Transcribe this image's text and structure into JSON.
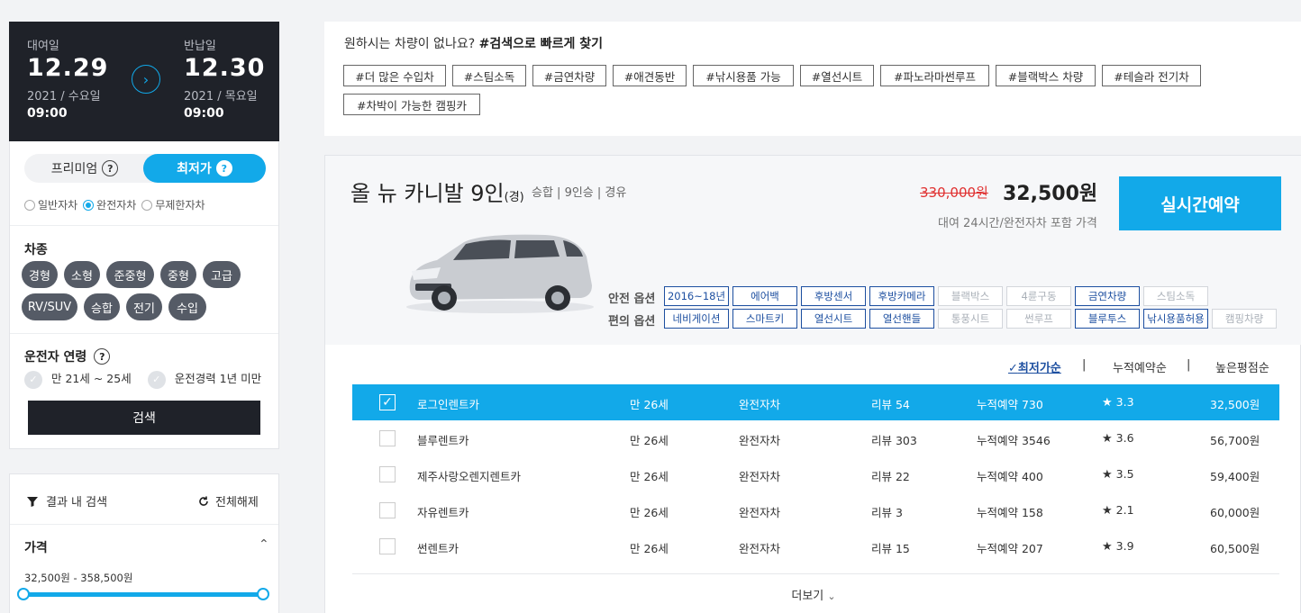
{
  "dates": {
    "pickup": {
      "label": "대여일",
      "date": "12.29",
      "sub": "2021 / 수요일",
      "time": "09:00"
    },
    "return": {
      "label": "반납일",
      "date": "12.30",
      "sub": "2021 / 목요일",
      "time": "09:00"
    }
  },
  "toggle": {
    "premium": "프리미엄",
    "cheapest": "최저가"
  },
  "insurance": [
    "일반자차",
    "완전자차",
    "무제한자차"
  ],
  "car_type": {
    "title": "차종",
    "chips": [
      "경형",
      "소형",
      "준중형",
      "중형",
      "고급",
      "RV/SUV",
      "승합",
      "전기",
      "수입"
    ]
  },
  "driver": {
    "title": "운전자 연령",
    "age": "만 21세 ~ 25세",
    "exp": "운전경력 1년 미만"
  },
  "search_label": "검색",
  "filter": {
    "search_in_results": "결과 내 검색",
    "reset": "전체해제",
    "price_title": "가격",
    "price_range": "32,500원 - 358,500원"
  },
  "tags": {
    "title_plain": "원하시는 차량이 없나요?",
    "title_bold": "#검색으로 빠르게 찾기",
    "items": [
      "#더 많은 수입차",
      "#스팀소독",
      "#금연차량",
      "#애견동반",
      "#낚시용품 가능",
      "#열선시트",
      "#파노라마썬루프",
      "#블랙박스 차량",
      "#테슬라 전기차",
      "#차박이 가능한 캠핑카"
    ]
  },
  "car": {
    "name": "올 뉴 카니발 9인",
    "fuel_short": "(경)",
    "meta": "승합 | 9인승 | 경유",
    "old_price": "330,000원",
    "price": "32,500원",
    "price_note": "대여 24시간/완전자차 포함 가격",
    "reserve": "실시간예약",
    "safety_label": "안전 옵션",
    "safety": [
      {
        "t": "2016~18년",
        "on": true
      },
      {
        "t": "에어백",
        "on": true
      },
      {
        "t": "후방센서",
        "on": true
      },
      {
        "t": "후방카메라",
        "on": true
      },
      {
        "t": "블랙박스",
        "on": false
      },
      {
        "t": "4륜구동",
        "on": false
      },
      {
        "t": "금연차량",
        "on": true
      },
      {
        "t": "스팀소독",
        "on": false
      }
    ],
    "comfort_label": "편의 옵션",
    "comfort": [
      {
        "t": "네비게이션",
        "on": true
      },
      {
        "t": "스마트키",
        "on": true
      },
      {
        "t": "열선시트",
        "on": true
      },
      {
        "t": "열선핸들",
        "on": true
      },
      {
        "t": "통풍시트",
        "on": false
      },
      {
        "t": "썬루프",
        "on": false
      },
      {
        "t": "블루투스",
        "on": true
      },
      {
        "t": "낚시용품허용",
        "on": true
      },
      {
        "t": "캠핑차량",
        "on": false
      }
    ]
  },
  "sort": {
    "cheapest": "최저가순",
    "reservations": "누적예약순",
    "rating": "높은평점순"
  },
  "companies": [
    {
      "name": "로그인렌트카",
      "age": "만 26세",
      "ins": "완전자차",
      "review": "리뷰 54",
      "booked": "누적예약 730",
      "rating": "3.3",
      "price": "32,500원",
      "selected": true
    },
    {
      "name": "블루렌트카",
      "age": "만 26세",
      "ins": "완전자차",
      "review": "리뷰 303",
      "booked": "누적예약 3546",
      "rating": "3.6",
      "price": "56,700원",
      "selected": false
    },
    {
      "name": "제주사랑오렌지렌트카",
      "age": "만 26세",
      "ins": "완전자차",
      "review": "리뷰 22",
      "booked": "누적예약 400",
      "rating": "3.5",
      "price": "59,400원",
      "selected": false
    },
    {
      "name": "자유렌트카",
      "age": "만 26세",
      "ins": "완전자차",
      "review": "리뷰 3",
      "booked": "누적예약 158",
      "rating": "2.1",
      "price": "60,000원",
      "selected": false
    },
    {
      "name": "썬렌트카",
      "age": "만 26세",
      "ins": "완전자차",
      "review": "리뷰 15",
      "booked": "누적예약 207",
      "rating": "3.9",
      "price": "60,500원",
      "selected": false
    }
  ],
  "more": "더보기",
  "colors": {
    "accent": "#12a9e9",
    "dark": "#1f2229",
    "option_on": "#1d4fa0",
    "strike": "#e03131"
  }
}
